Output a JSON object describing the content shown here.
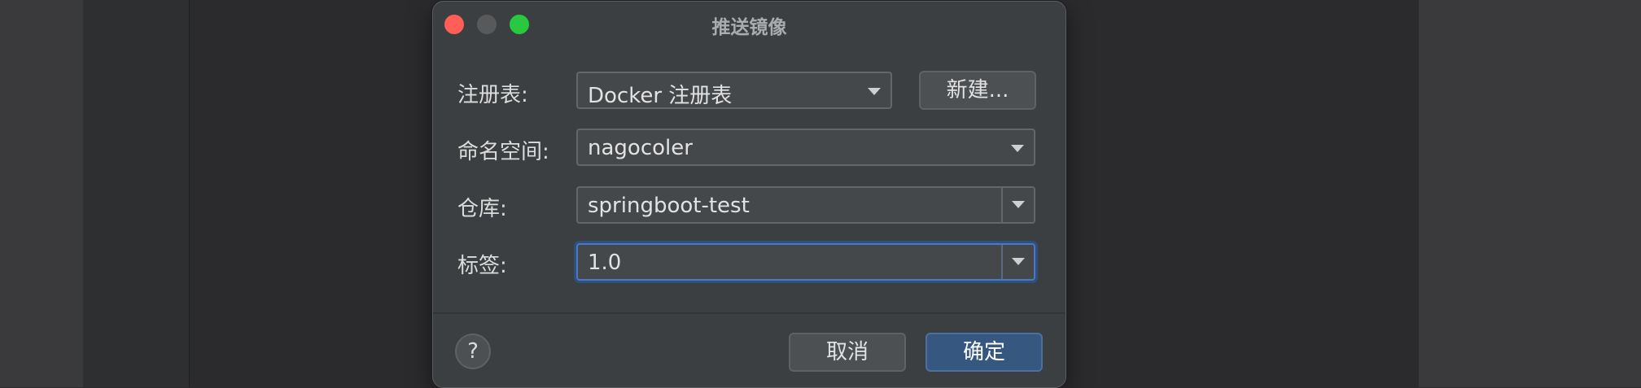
{
  "dialog": {
    "title": "推送镜像",
    "fields": {
      "registry": {
        "label": "注册表:",
        "value": "Docker 注册表",
        "new_button": "新建..."
      },
      "namespace": {
        "label": "命名空间:",
        "value": "nagocoler"
      },
      "repository": {
        "label": "仓库:",
        "value": "springboot-test"
      },
      "tag": {
        "label": "标签:",
        "value": "1.0"
      }
    },
    "help_label": "?",
    "cancel_label": "取消",
    "ok_label": "确定"
  },
  "colors": {
    "dialog_bg": "#3c3f41",
    "primary_button": "#365880",
    "focus_ring": "#4a78c2",
    "close": "#ff5f57",
    "zoom": "#28c840"
  }
}
